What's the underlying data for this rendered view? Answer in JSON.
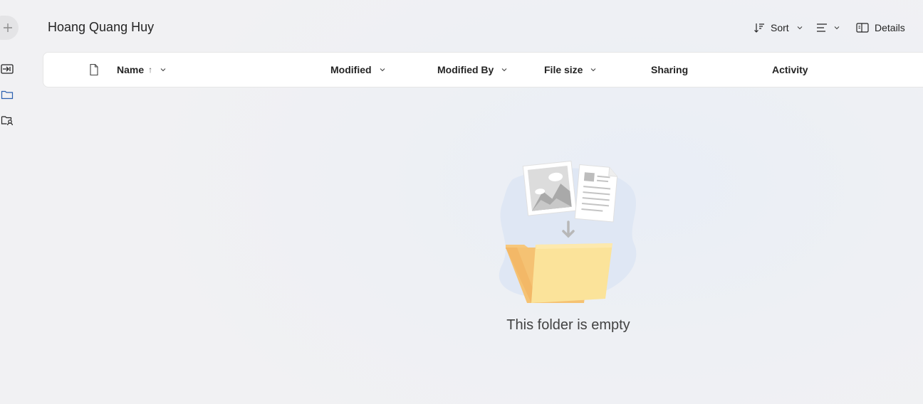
{
  "header": {
    "title": "Hoang Quang Huy"
  },
  "toolbar": {
    "sort_label": "Sort",
    "details_label": "Details"
  },
  "columns": {
    "name": "Name",
    "name_sort_indicator": "↑",
    "modified": "Modified",
    "modified_by": "Modified By",
    "file_size": "File size",
    "sharing": "Sharing",
    "activity": "Activity"
  },
  "empty_state": {
    "message": "This folder is empty"
  },
  "icons": {
    "new": "plus-icon",
    "rail": [
      "move-to-icon",
      "folder-icon",
      "shared-folder-icon"
    ],
    "sort": "sort-icon",
    "view": "list-view-icon",
    "details": "details-pane-icon",
    "file_type": "file-icon"
  },
  "colors": {
    "folder_front": "#fbe39a",
    "folder_back": "#f7c77c",
    "blob": "#dfe7f4"
  }
}
